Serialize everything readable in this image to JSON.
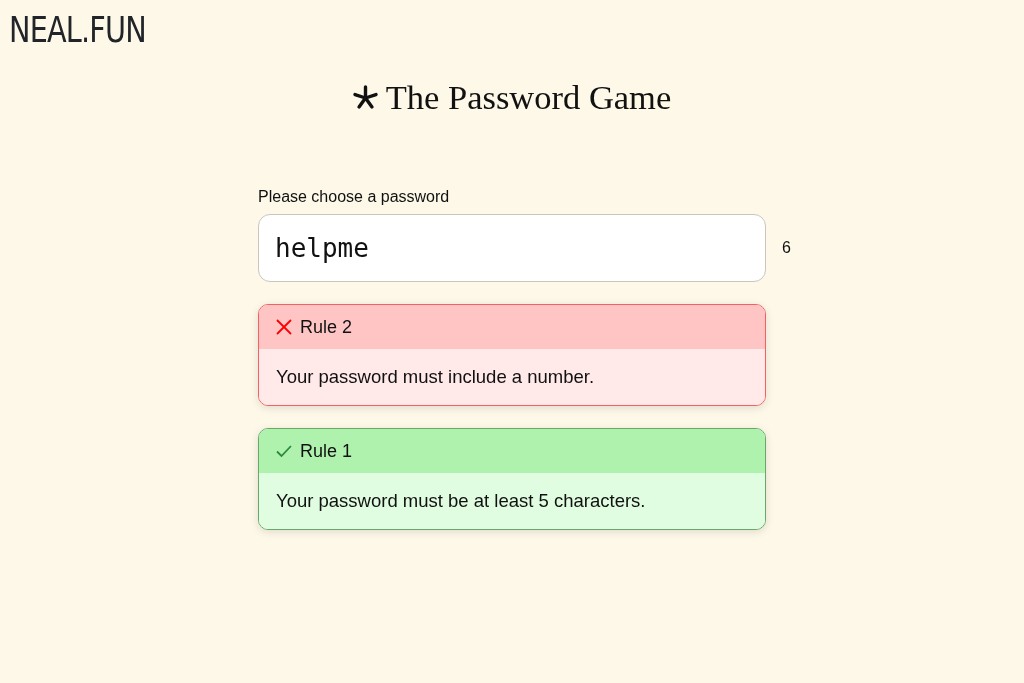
{
  "site": {
    "logo": "NEAL.FUN"
  },
  "title": "The Password Game",
  "password": {
    "label": "Please choose a password",
    "value": "helpme",
    "length": "6"
  },
  "rules": [
    {
      "title": "Rule 2",
      "text": "Your password must include a number.",
      "passed": false
    },
    {
      "title": "Rule 1",
      "text": "Your password must be at least 5 characters.",
      "passed": true
    }
  ]
}
